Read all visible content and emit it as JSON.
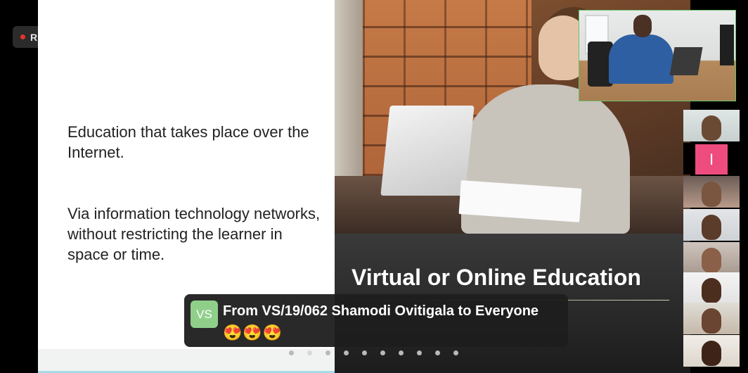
{
  "recording": {
    "label": "REC",
    "color": "#e0342b"
  },
  "slide": {
    "paragraphs": [
      "Education that takes place over the Internet.",
      "Via information technology networks, without restricting the learner in space or time."
    ],
    "title": "Virtual or Online Education",
    "pagination_count": 10
  },
  "chat": {
    "avatar_initials": "VS",
    "avatar_color": "#8fcf8a",
    "from_line": "From VS/19/062 Shamodi Ovitigala to Everyone",
    "message": "😍😍😍"
  },
  "participants": {
    "main_speaker": {
      "type": "video"
    },
    "gallery": [
      {
        "type": "video"
      },
      {
        "type": "avatar",
        "initial": "I",
        "color": "#ee4b7e"
      },
      {
        "type": "video"
      },
      {
        "type": "video"
      },
      {
        "type": "video"
      },
      {
        "type": "video"
      },
      {
        "type": "video"
      },
      {
        "type": "video"
      }
    ]
  }
}
